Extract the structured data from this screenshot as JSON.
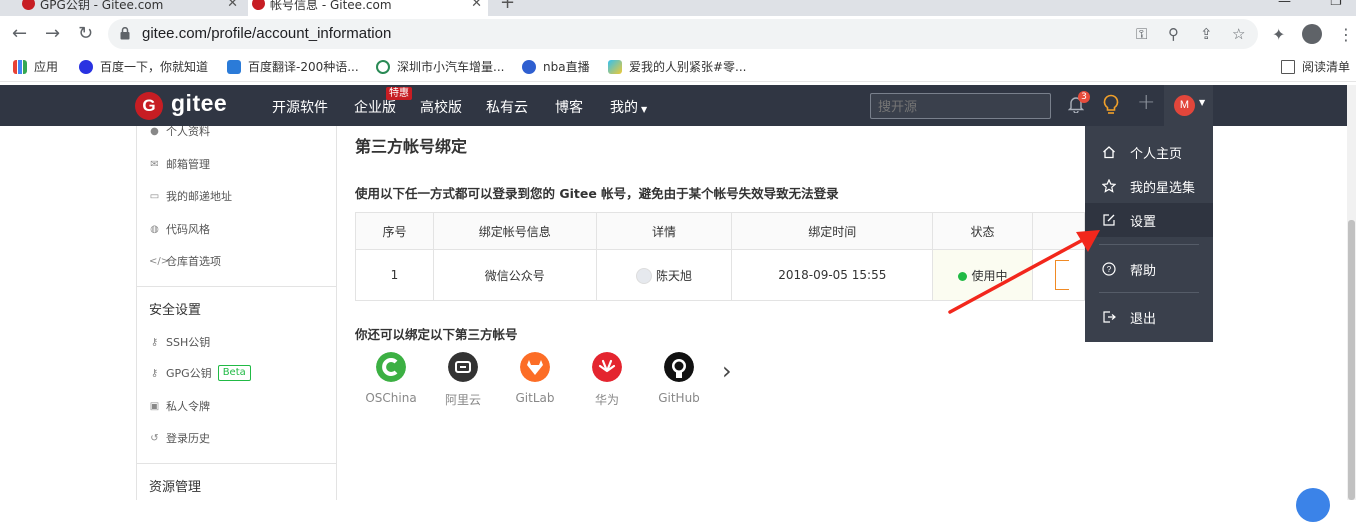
{
  "browser": {
    "tabs": [
      {
        "title": "GPG公钥 - Gitee.com"
      },
      {
        "title": "帐号信息 - Gitee.com"
      }
    ],
    "url": "gitee.com/profile/account_information",
    "bookmarks": [
      {
        "label": "应用",
        "icon": "apps-grid-icon"
      },
      {
        "label": "百度一下，你就知道",
        "icon": "baidu-icon"
      },
      {
        "label": "百度翻译-200种语...",
        "icon": "translate-icon"
      },
      {
        "label": "深圳市小汽车增量...",
        "icon": "globe-icon"
      },
      {
        "label": "nba直播",
        "icon": "jrs-icon"
      },
      {
        "label": "爱我的人别紧张#零...",
        "icon": "play-icon"
      }
    ],
    "reading_list": "阅读清单"
  },
  "header": {
    "logo_mark": "G",
    "logo_text": "gitee",
    "nav": [
      "开源软件",
      "企业版",
      "高校版",
      "私有云",
      "博客",
      "我的"
    ],
    "hot_badge": "特惠",
    "search_placeholder": "搜开源",
    "notification_count": "3",
    "avatar_letter": "M"
  },
  "sidebar": {
    "top_items": [
      {
        "label": "个人资料",
        "icon": "user-icon"
      },
      {
        "label": "邮箱管理",
        "icon": "mail-icon"
      },
      {
        "label": "我的邮递地址",
        "icon": "address-card-icon"
      },
      {
        "label": "代码风格",
        "icon": "palette-icon"
      },
      {
        "label": "仓库首选项",
        "icon": "code-icon"
      }
    ],
    "security_heading": "安全设置",
    "security_items": [
      {
        "label": "SSH公钥",
        "icon": "key-icon"
      },
      {
        "label": "GPG公钥",
        "icon": "key-icon",
        "badge": "Beta"
      },
      {
        "label": "私人令牌",
        "icon": "lock-icon"
      },
      {
        "label": "登录历史",
        "icon": "history-icon"
      }
    ],
    "resource_heading": "资源管理"
  },
  "main": {
    "title": "第三方帐号绑定",
    "subtitle": "使用以下任一方式都可以登录到您的 Gitee 帐号，避免由于某个帐号失效导致无法登录",
    "table": {
      "headers": [
        "序号",
        "绑定帐号信息",
        "详情",
        "绑定时间",
        "状态",
        ""
      ],
      "rows": [
        {
          "index": "1",
          "account": "微信公众号",
          "detail": "陈天旭",
          "time": "2018-09-05 15:55",
          "status": "使用中"
        }
      ]
    },
    "more_title": "你还可以绑定以下第三方帐号",
    "providers": [
      {
        "label": "OSChina",
        "color": "#3cb043"
      },
      {
        "label": "阿里云",
        "color": "#333333"
      },
      {
        "label": "GitLab",
        "color": "#fc6d26"
      },
      {
        "label": "华为",
        "color": "#e4252f"
      },
      {
        "label": "GitHub",
        "color": "#111111"
      }
    ]
  },
  "dropdown": {
    "items": [
      {
        "label": "个人主页",
        "icon": "home-icon"
      },
      {
        "label": "我的星选集",
        "icon": "star-icon"
      },
      {
        "label": "设置",
        "icon": "edit-icon",
        "active": true
      },
      {
        "label": "帮助",
        "icon": "help-icon"
      },
      {
        "label": "退出",
        "icon": "logout-icon"
      }
    ]
  },
  "colors": {
    "brand_red": "#c71d23",
    "header_bg": "#303643",
    "dropdown_bg": "#3a404c",
    "status_green": "#21ba45",
    "annotation_red": "#f2271c"
  }
}
